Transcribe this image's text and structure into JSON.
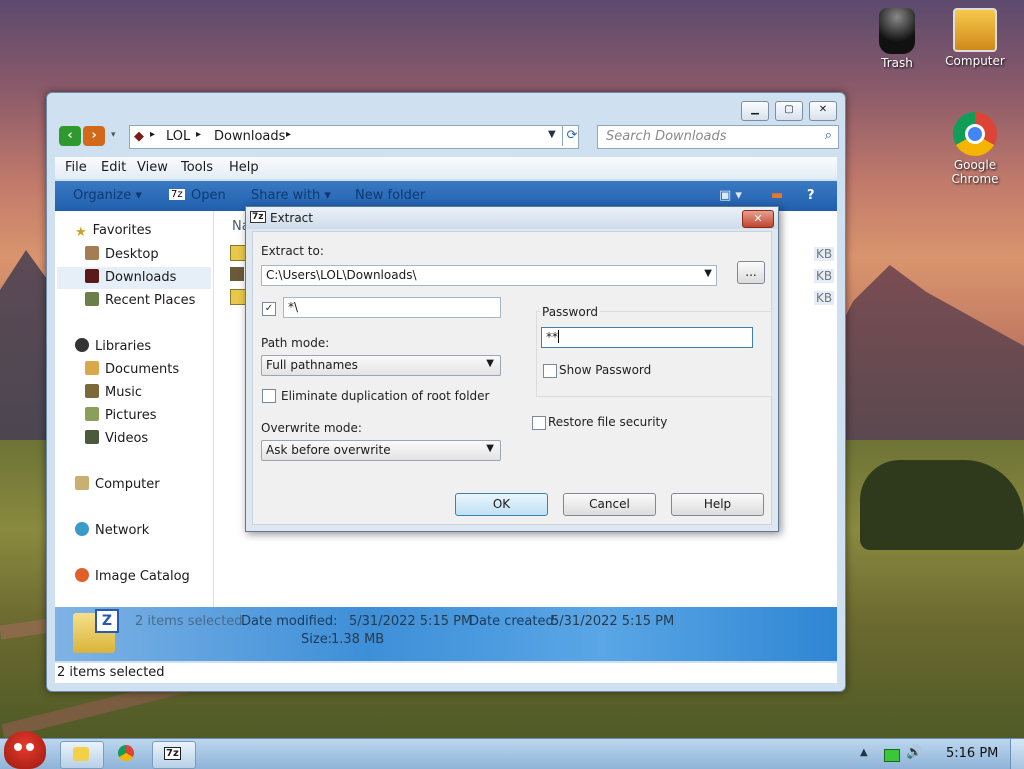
{
  "desktop": {
    "icons": [
      {
        "label": "Trash"
      },
      {
        "label": "Computer"
      },
      {
        "label": "Google Chrome"
      }
    ]
  },
  "explorer": {
    "breadcrumb": [
      "LOL",
      "Downloads"
    ],
    "search_placeholder": "Search Downloads",
    "menu": [
      "File",
      "Edit",
      "View",
      "Tools",
      "Help"
    ],
    "toolbar": {
      "organize": "Organize ▾",
      "open": "Open",
      "share": "Share with ▾",
      "new_folder": "New folder"
    },
    "sidebar": {
      "favorites": "Favorites",
      "desktop": "Desktop",
      "downloads": "Downloads",
      "recent": "Recent Places",
      "libraries": "Libraries",
      "documents": "Documents",
      "music": "Music",
      "pictures": "Pictures",
      "videos": "Videos",
      "computer": "Computer",
      "network": "Network",
      "image_catalog": "Image Catalog"
    },
    "column_header_partial": "Na",
    "size_partial": [
      "KB",
      "KB",
      "KB"
    ],
    "details": {
      "selected": "2 items selected",
      "date_modified_label": "Date modified:",
      "date_modified": "5/31/2022 5:15 PM",
      "date_created_label": "Date created:",
      "date_created": "5/31/2022 5:15 PM",
      "size_label": "Size:",
      "size": "1.38 MB"
    },
    "status": "2 items selected"
  },
  "dialog": {
    "title": "Extract",
    "extract_to_label": "Extract to:",
    "extract_to_value": "C:\\Users\\LOL\\Downloads\\",
    "browse_label": "...",
    "subfolder_value": "*\\",
    "path_mode_label": "Path mode:",
    "path_mode_value": "Full pathnames",
    "eliminate_label": "Eliminate duplication of root folder",
    "overwrite_label": "Overwrite mode:",
    "overwrite_value": "Ask before overwrite",
    "password_group": "Password",
    "password_value": "**",
    "show_password": "Show Password",
    "restore_security": "Restore file security",
    "ok": "OK",
    "cancel": "Cancel",
    "help": "Help"
  },
  "taskbar": {
    "clock": "5:16 PM",
    "seven_zip": "7z"
  }
}
